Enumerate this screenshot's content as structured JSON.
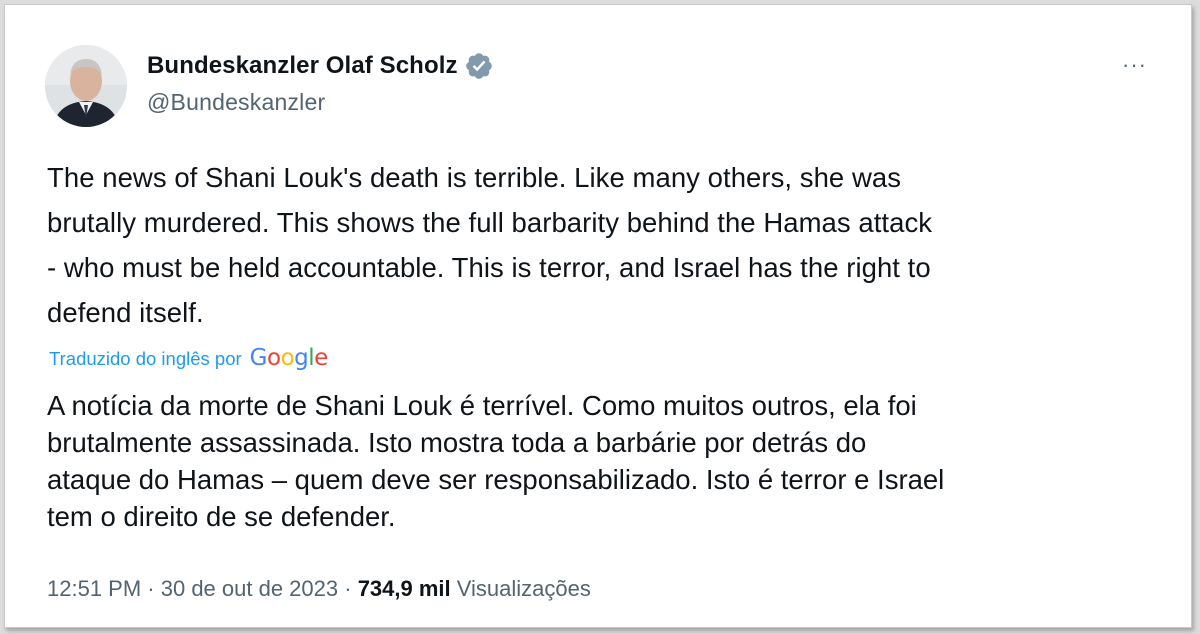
{
  "author": {
    "display_name": "Bundeskanzler Olaf Scholz",
    "handle": "@Bundeskanzler",
    "verified_icon": "verified-badge-icon",
    "verified_color": "#829aab"
  },
  "menu": {
    "more_label": "···"
  },
  "tweet": {
    "text": "The news of Shani Louk's death is terrible. Like many others, she was\nbrutally murdered. This shows the full barbarity behind the Hamas attack\n- who must be held accountable. This is terror, and Israel has the right to\ndefend itself."
  },
  "translation": {
    "label": "Traduzido do inglês por",
    "provider_letters": [
      {
        "char": "G",
        "color": "#4285f4"
      },
      {
        "char": "o",
        "color": "#ea4335"
      },
      {
        "char": "o",
        "color": "#fbbc05"
      },
      {
        "char": "g",
        "color": "#4285f4"
      },
      {
        "char": "l",
        "color": "#34a853"
      },
      {
        "char": "e",
        "color": "#ea4335"
      }
    ],
    "text": "A notícia da morte de Shani Louk é terrível. Como muitos outros, ela foi\nbrutalmente assassinada. Isto mostra toda a barbárie por detrás do\nataque do Hamas – quem deve ser responsabilizado. Isto é terror e Israel\ntem o direito de se defender."
  },
  "meta": {
    "time": "12:51 PM",
    "separator": " · ",
    "date": "30 de out de 2023",
    "views_count": "734,9 mil",
    "views_label": " Visualizações"
  },
  "colors": {
    "link": "#1d9bf0",
    "secondary_text": "#536471",
    "primary_text": "#0f1419"
  }
}
